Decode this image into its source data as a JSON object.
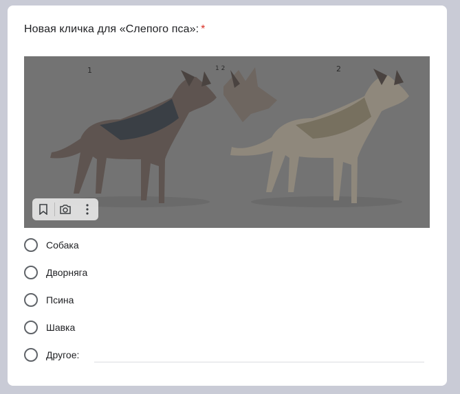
{
  "question": {
    "title": "Новая кличка для «Слепого пса»:",
    "required_mark": "*"
  },
  "image": {
    "sketch_labels": [
      "1",
      "1 2",
      "2"
    ],
    "toolbar_icons": [
      "bookmark-icon",
      "camera-icon",
      "more-vert-icon"
    ]
  },
  "options": [
    {
      "label": "Собака"
    },
    {
      "label": "Дворняга"
    },
    {
      "label": "Псина"
    },
    {
      "label": "Шавка"
    },
    {
      "label": "Другое:"
    }
  ],
  "other_input": {
    "value": "",
    "placeholder": ""
  },
  "colors": {
    "background": "#c9cbd6",
    "card": "#ffffff",
    "required": "#d93025",
    "radio_border": "#5f6368"
  }
}
